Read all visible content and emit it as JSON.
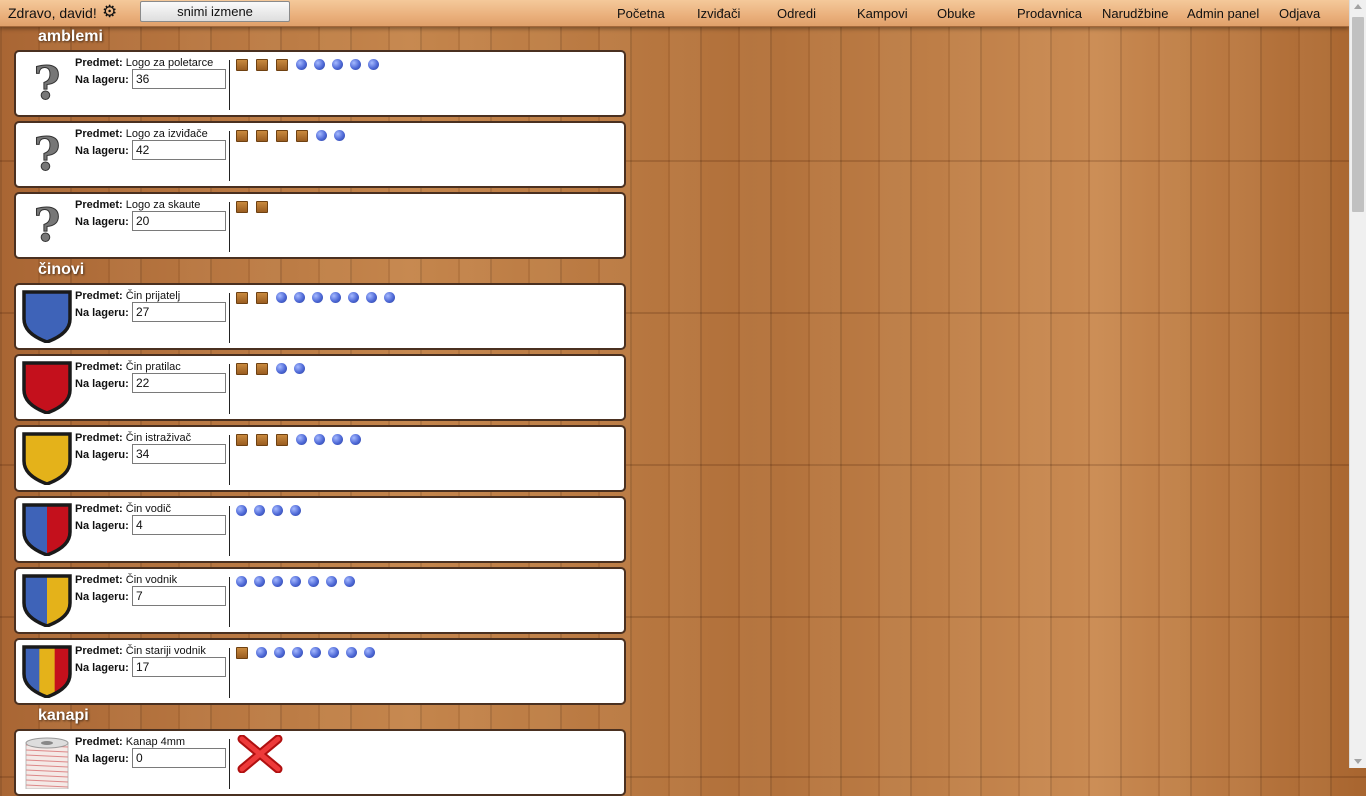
{
  "header": {
    "greeting": "Zdravo, david!",
    "save_label": "snimi izmene",
    "nav": [
      "Početna",
      "Izviđači",
      "Odredi",
      "Kampovi",
      "Obuke",
      "Prodavnica",
      "Narudžbine",
      "Admin panel",
      "Odjava"
    ]
  },
  "labels": {
    "item": "Predmet:",
    "stock": "Na lageru:"
  },
  "sections": [
    {
      "title": "amblemi"
    },
    {
      "title": "činovi"
    },
    {
      "title": "kanapi"
    }
  ],
  "items": [
    {
      "name": "Logo za poletarce",
      "stock": "36",
      "icon": "question-mark-icon",
      "marks": [
        "sq",
        "sq",
        "sq",
        "ci",
        "ci",
        "ci",
        "ci",
        "ci"
      ]
    },
    {
      "name": "Logo za izviđače",
      "stock": "42",
      "icon": "question-mark-icon",
      "marks": [
        "sq",
        "sq",
        "sq",
        "sq",
        "ci",
        "ci"
      ]
    },
    {
      "name": "Logo za skaute",
      "stock": "20",
      "icon": "question-mark-icon",
      "marks": [
        "sq",
        "sq"
      ]
    },
    {
      "name": "Čin prijatelj",
      "stock": "27",
      "icon": "shield-icon",
      "colors": [
        "#3e63b8"
      ],
      "marks": [
        "sq",
        "sq",
        "ci",
        "ci",
        "ci",
        "ci",
        "ci",
        "ci",
        "ci"
      ]
    },
    {
      "name": "Čin pratilac",
      "stock": "22",
      "icon": "shield-icon",
      "colors": [
        "#c4101c"
      ],
      "marks": [
        "sq",
        "sq",
        "ci",
        "ci"
      ]
    },
    {
      "name": "Čin istraživač",
      "stock": "34",
      "icon": "shield-icon",
      "colors": [
        "#e4b21a"
      ],
      "marks": [
        "sq",
        "sq",
        "sq",
        "ci",
        "ci",
        "ci",
        "ci"
      ]
    },
    {
      "name": "Čin vodič",
      "stock": "4",
      "icon": "shield-icon",
      "colors": [
        "#3e63b8",
        "#c4101c"
      ],
      "marks": [
        "ci",
        "ci",
        "ci",
        "ci"
      ]
    },
    {
      "name": "Čin vodnik",
      "stock": "7",
      "icon": "shield-icon",
      "colors": [
        "#3e63b8",
        "#e4b21a"
      ],
      "marks": [
        "ci",
        "ci",
        "ci",
        "ci",
        "ci",
        "ci",
        "ci"
      ]
    },
    {
      "name": "Čin stariji vodnik",
      "stock": "17",
      "icon": "shield-icon",
      "colors": [
        "#3e63b8",
        "#e4b21a",
        "#c4101c"
      ],
      "marks": [
        "sq",
        "ci",
        "ci",
        "ci",
        "ci",
        "ci",
        "ci",
        "ci"
      ]
    },
    {
      "name": "Kanap 4mm",
      "stock": "0",
      "icon": "rope-spool-icon",
      "marks": [
        "x"
      ]
    }
  ]
}
